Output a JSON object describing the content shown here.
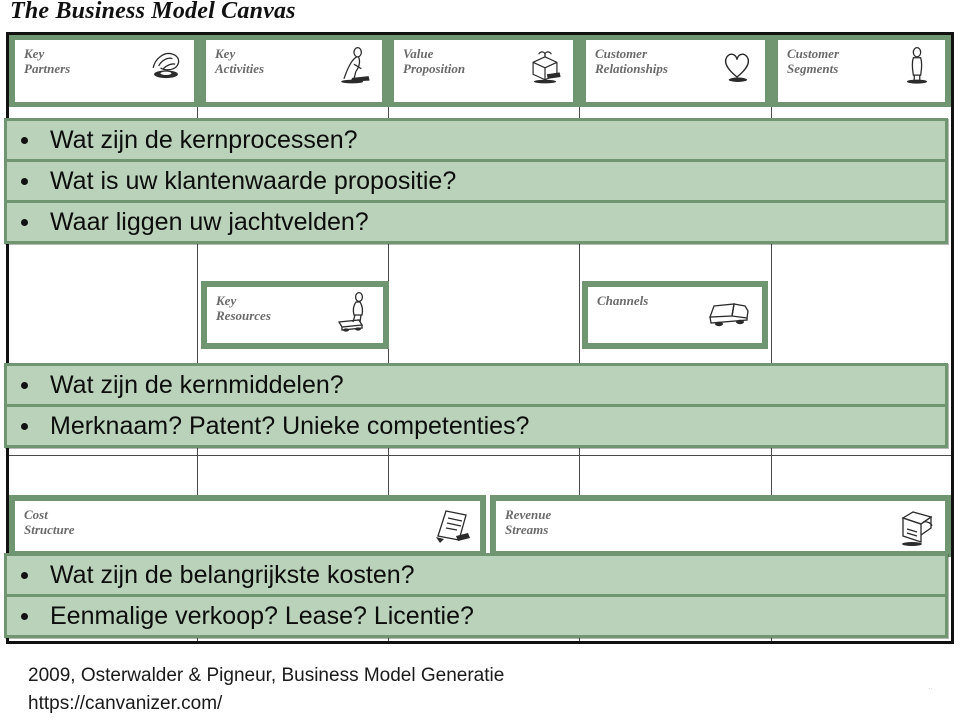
{
  "slide": {
    "title": "The Business Model Canvas",
    "credit_line_1": "2009, Osterwalder & Pigneur,  Business Model Generatie",
    "credit_line_2": "https://canvanizer.com/",
    "credit_full": "2009, Osterwalder & Pigneur,  Business Model Generatie\nhttps://canvanizer.com/",
    "artifact_mark": ".."
  },
  "colors": {
    "band_green": "#6f9670",
    "highlight_green": "#b9d2b9",
    "frame_black": "#111111",
    "label_gray": "#6a6a6a"
  },
  "canvas_blocks": [
    {
      "id": "key-partners",
      "label": "Key\nPartners",
      "icon": "handshake-icon"
    },
    {
      "id": "key-activities",
      "label": "Key\nActivities",
      "icon": "worker-icon"
    },
    {
      "id": "value-proposition",
      "label": "Value\nProposition",
      "icon": "gift-box-icon"
    },
    {
      "id": "customer-relationships",
      "label": "Customer\nRelationships",
      "icon": "heart-icon"
    },
    {
      "id": "customer-segments",
      "label": "Customer\nSegments",
      "icon": "person-icon"
    },
    {
      "id": "key-resources",
      "label": "Key\nResources",
      "icon": "crane-icon"
    },
    {
      "id": "channels",
      "label": "Channels",
      "icon": "truck-icon"
    },
    {
      "id": "cost-structure",
      "label": "Cost\nStructure",
      "icon": "invoice-icon"
    },
    {
      "id": "revenue-streams",
      "label": "Revenue\nStreams",
      "icon": "cash-register-icon"
    }
  ],
  "text_blocks": [
    {
      "id": "activities-value-channels-questions",
      "bullets": [
        "Wat zijn de kernprocessen?",
        "Wat is uw klantenwaarde propositie?",
        "Waar liggen uw jachtvelden?"
      ]
    },
    {
      "id": "resources-questions",
      "bullets": [
        "Wat zijn de kernmiddelen?",
        "Merknaam? Patent? Unieke competenties?"
      ]
    },
    {
      "id": "cost-revenue-questions",
      "bullets": [
        "Wat zijn de belangrijkste kosten?",
        "Eenmalige verkoop? Lease? Licentie?"
      ]
    }
  ]
}
